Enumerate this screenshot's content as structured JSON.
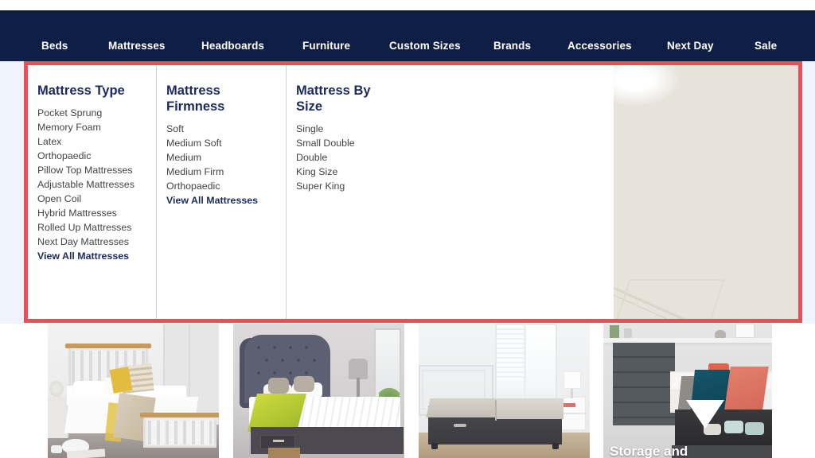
{
  "nav": {
    "items": [
      {
        "label": "Beds",
        "key": "beds"
      },
      {
        "label": "Mattresses",
        "key": "mattresses"
      },
      {
        "label": "Headboards",
        "key": "headboards"
      },
      {
        "label": "Furniture",
        "key": "furniture"
      },
      {
        "label": "Custom Sizes",
        "key": "customsizes"
      },
      {
        "label": "Brands",
        "key": "brands"
      },
      {
        "label": "Accessories",
        "key": "accessories"
      },
      {
        "label": "Next Day",
        "key": "nextday"
      },
      {
        "label": "Sale",
        "key": "sale"
      }
    ],
    "background_color": "#0f1e45",
    "text_color": "#ffffff"
  },
  "mega_menu": {
    "highlight_color": "#ef4c59",
    "heading_color": "#1b2a5e",
    "link_color": "#444444",
    "columns": [
      {
        "title": "Mattress Type",
        "links": [
          "Pocket Sprung",
          "Memory Foam",
          "Latex",
          "Orthopaedic",
          "Pillow Top Mattresses",
          "Adjustable Mattresses",
          "Open Coil",
          "Hybrid Mattresses",
          "Rolled Up Mattresses",
          "Next Day Mattresses"
        ],
        "view_all": "View All Mattresses"
      },
      {
        "title": "Mattress Firmness",
        "links": [
          "Soft",
          "Medium Soft",
          "Medium",
          "Medium Firm",
          "Orthopaedic"
        ],
        "view_all": "View All Mattresses"
      },
      {
        "title": "Mattress By Size",
        "links": [
          "Single",
          "Small Double",
          "Double",
          "King Size",
          "Super King"
        ],
        "view_all": null
      }
    ],
    "promo_image": "quilted-mattress-closeup-image"
  },
  "tiles": [
    {
      "name": "white-wooden-bed-frame-image",
      "caption": null
    },
    {
      "name": "grey-upholstered-winged-divan-bed-image",
      "caption": null
    },
    {
      "name": "grey-divan-bed-base-image",
      "caption": null
    },
    {
      "name": "storage-ottoman-bed-image",
      "caption": "Storage and"
    }
  ]
}
